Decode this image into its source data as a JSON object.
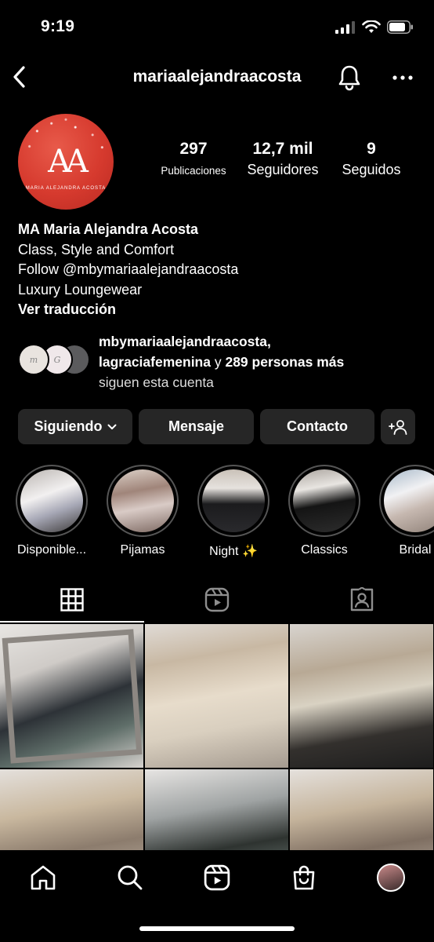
{
  "status_bar": {
    "time": "9:19"
  },
  "header": {
    "username": "mariaalejandraacosta"
  },
  "profile": {
    "avatar_monogram": "AA",
    "avatar_brand": "MARIA ALEJANDRA ACOSTA",
    "stats": {
      "posts_count": "297",
      "posts_label": "Publicaciones",
      "followers_count": "12,7 mil",
      "followers_label": "Seguidores",
      "following_count": "9",
      "following_label": "Seguidos"
    },
    "bio": {
      "name": "MA Maria Alejandra Acosta",
      "line1": "Class, Style and Comfort",
      "line2": "Follow @mbymariaalejandraacosta",
      "line3": "Luxury Loungewear",
      "translate": "Ver traducción"
    },
    "followed_by": {
      "users_line1": "mbymariaalejandraacosta,",
      "users_line2_user": "lagraciafemenina",
      "users_line2_conj": " y ",
      "users_line2_rest": "289 personas más",
      "suffix": "siguen esta cuenta"
    }
  },
  "actions": {
    "following": "Siguiendo",
    "message": "Mensaje",
    "contact": "Contacto"
  },
  "highlights": [
    {
      "label": "Disponible..."
    },
    {
      "label": "Pijamas"
    },
    {
      "label": "Night ✨"
    },
    {
      "label": "Classics"
    },
    {
      "label": "Bridal"
    }
  ],
  "tabs": [
    "grid",
    "reels",
    "tagged"
  ],
  "active_tab": "grid",
  "colors": {
    "background": "#000000",
    "button": "#262626",
    "text": "#ffffff",
    "avatar": "#d63a2e"
  },
  "icons": {
    "back": "back-arrow-icon",
    "bell": "bell-icon",
    "more": "more-icon",
    "chevron": "chevron-down-icon",
    "add_user": "add-user-icon",
    "grid": "grid-icon",
    "reels": "reels-icon",
    "tagged": "tagged-icon",
    "home": "home-icon",
    "search": "search-icon",
    "shop": "shop-icon"
  }
}
